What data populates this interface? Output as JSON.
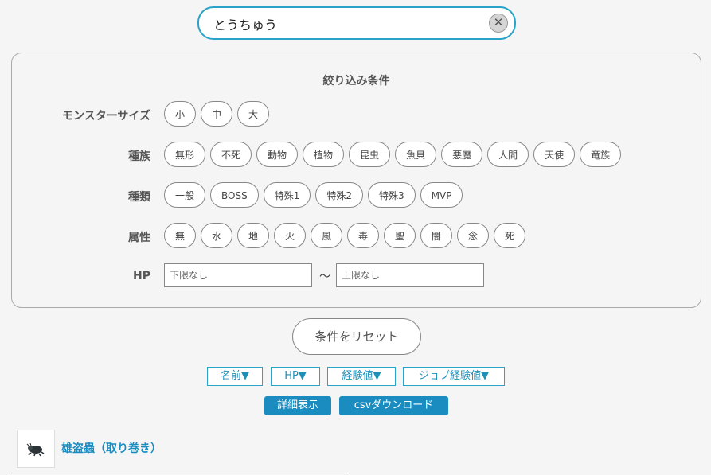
{
  "search": {
    "value": "とうちゅう",
    "clear_label": "✕"
  },
  "filter": {
    "title": "絞り込み条件",
    "size": {
      "label": "モンスターサイズ",
      "options": [
        "小",
        "中",
        "大"
      ]
    },
    "race": {
      "label": "種族",
      "options": [
        "無形",
        "不死",
        "動物",
        "植物",
        "昆虫",
        "魚貝",
        "悪魔",
        "人間",
        "天使",
        "竜族"
      ]
    },
    "type": {
      "label": "種類",
      "options": [
        "一般",
        "BOSS",
        "特殊1",
        "特殊2",
        "特殊3",
        "MVP"
      ]
    },
    "element": {
      "label": "属性",
      "options": [
        "無",
        "水",
        "地",
        "火",
        "風",
        "毒",
        "聖",
        "闇",
        "念",
        "死"
      ]
    },
    "hp": {
      "label": "HP",
      "min_placeholder": "下限なし",
      "max_placeholder": "上限なし",
      "separator": "～"
    }
  },
  "reset_label": "条件をリセット",
  "sort": [
    "名前▼",
    "HP▼",
    "経験値▼",
    "ジョブ経験値▼"
  ],
  "actions": {
    "detail": "詳細表示",
    "csv": "csvダウンロード"
  },
  "results": [
    {
      "name": "雄盗蟲（取り巻き）"
    }
  ],
  "colors": {
    "accent": "#29a3c8",
    "button": "#1a8cc0"
  }
}
